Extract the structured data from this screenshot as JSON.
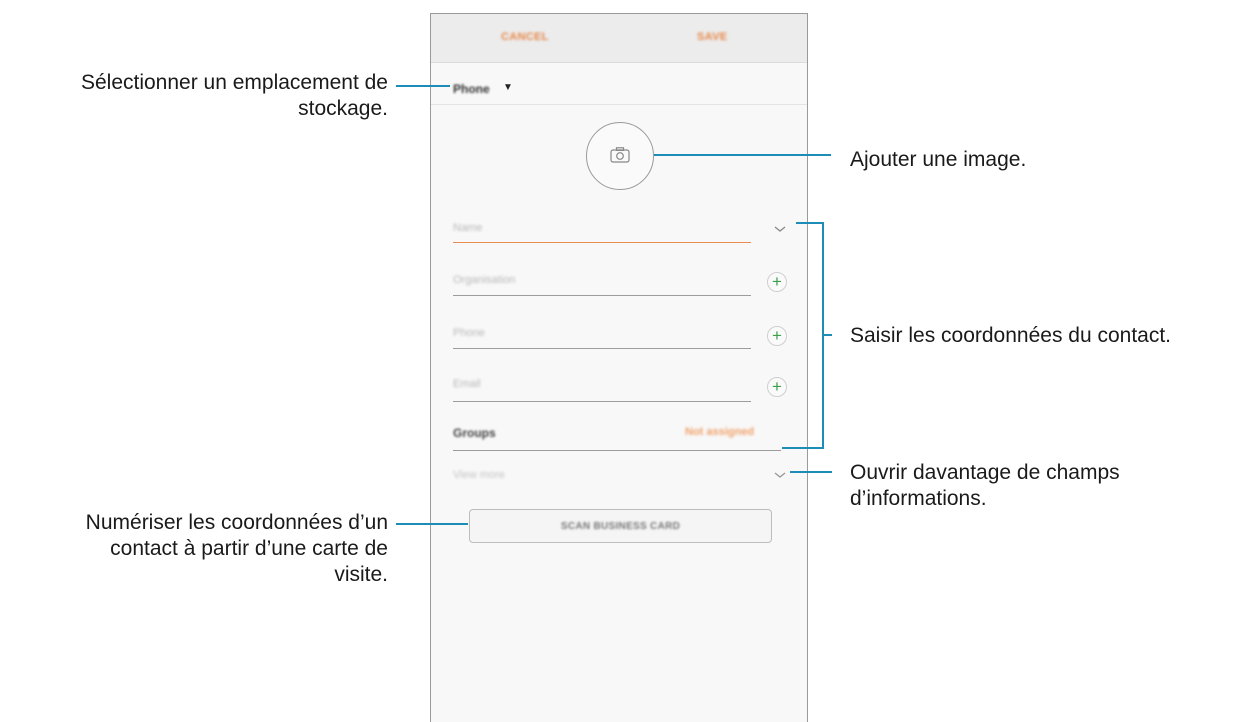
{
  "screen": {
    "topbar": {
      "cancel_label": "CANCEL",
      "save_label": "SAVE"
    },
    "storage": {
      "label": "Phone",
      "caret": "▼"
    },
    "photo": {
      "icon": "camera-icon"
    },
    "fields": {
      "name_placeholder": "Name",
      "organisation_placeholder": "Organisation",
      "phone_placeholder": "Phone",
      "email_placeholder": "Email"
    },
    "groups": {
      "label": "Groups",
      "value": "Not assigned"
    },
    "view_more_label": "View more",
    "scan_button_label": "SCAN BUSINESS CARD"
  },
  "annotations": {
    "storage_line1": "Sélectionner un emplacement de",
    "storage_line2": "stockage.",
    "image": "Ajouter une image.",
    "contact_info": "Saisir les coordonnées du contact.",
    "more_fields_line1": "Ouvrir davantage de champs",
    "more_fields_line2": "d’informations.",
    "scan_line1": "Numériser les coordonnées d’un",
    "scan_line2": "contact à partir d’une carte de",
    "scan_line3": "visite."
  },
  "colors": {
    "accent_orange": "#e6884a",
    "callout_line": "#1d8db8",
    "plus_green": "#3aa14a"
  }
}
